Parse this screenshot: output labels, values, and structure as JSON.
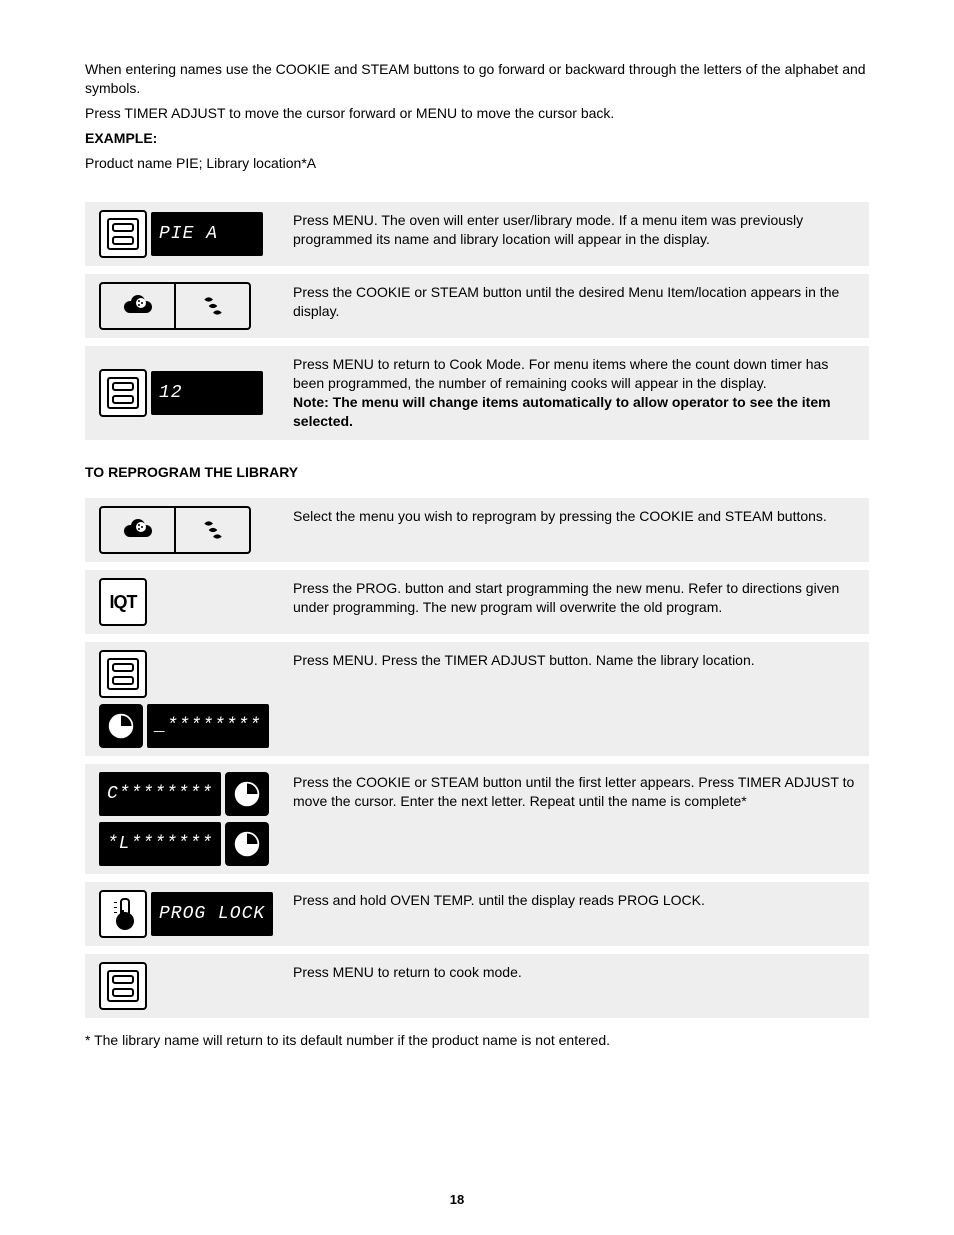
{
  "intro": {
    "p1": "When entering names use the COOKIE and STEAM buttons to go forward or backward through the letters of the alphabet and symbols.",
    "p2": "Press TIMER ADJUST to move the cursor forward or MENU to move the cursor back.",
    "example_title": "EXAMPLE:",
    "example_text": "Product name PIE; Library location*A"
  },
  "steps_a": [
    {
      "id": 0,
      "left": {
        "icons": [
          "menu"
        ],
        "display": "PIE A"
      },
      "right": "Press MENU. The oven will enter user/library mode. If a menu item was previously programmed its name and library location will appear in the display."
    },
    {
      "id": 1,
      "left": {
        "icons": [
          "cookie-steam"
        ]
      },
      "right": "Press the COOKIE or STEAM button until the desired Menu Item/location appears in the display."
    },
    {
      "id": 2,
      "left": {
        "icons": [
          "menu"
        ],
        "display": "12"
      },
      "right_main": "Press MENU to return to Cook Mode. For menu items where the count down timer has been programmed, the number of remaining cooks will appear in the display.",
      "right_note": "Note: The menu will change items automatically to allow operator to see the item selected."
    }
  ],
  "reprogram_title": "TO REPROGRAM THE LIBRARY",
  "steps_b": [
    {
      "id": 0,
      "left": {
        "icons": [
          "cookie-steam"
        ]
      },
      "right": "Select the menu you wish to reprogram by pressing the COOKIE and STEAM buttons."
    },
    {
      "id": 1,
      "left": {
        "icons": [
          "iqt"
        ]
      },
      "right": "Press the PROG. button and start programming the new menu. Refer to directions given under programming. The new program will overwrite the old program."
    },
    {
      "id": 2,
      "left_stack": [
        {
          "icons": [
            "menu"
          ]
        },
        {
          "icons": [
            "clock-black"
          ],
          "display": "_********"
        }
      ],
      "right": "Press MENU. Press the TIMER ADJUST button. Name the library location."
    },
    {
      "id": 3,
      "left_stack": [
        {
          "display": "C********",
          "icons_after": [
            "clock-black"
          ]
        },
        {
          "display": "*L*******",
          "icons_after": [
            "clock-black"
          ]
        }
      ],
      "right": "Press the COOKIE or STEAM button until the first letter appears. Press TIMER ADJUST to move the\ncursor. Enter the next letter. Repeat until the name is complete*"
    },
    {
      "id": 4,
      "left": {
        "icons": [
          "therm"
        ],
        "display": "PROG LOCK"
      },
      "right": "Press and hold OVEN TEMP. until the display reads PROG LOCK."
    },
    {
      "id": 5,
      "left": {
        "icons": [
          "menu"
        ]
      },
      "right": "Press MENU to return to cook mode."
    }
  ],
  "footnote": "* The library name will return to its default number if the product name is not entered.",
  "footer": {
    "doc_id": "",
    "page": "18"
  }
}
